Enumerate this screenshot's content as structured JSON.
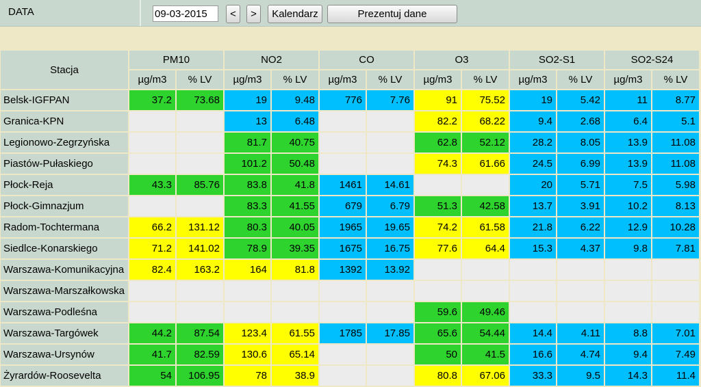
{
  "toolbar": {
    "label": "DATA",
    "date_value": "09-03-2015",
    "prev_label": "<",
    "next_label": ">",
    "calendar_label": "Kalendarz",
    "present_label": "Prezentuj dane"
  },
  "table": {
    "station_header": "Stacja",
    "pollutants": [
      "PM10",
      "NO2",
      "CO",
      "O3",
      "SO2-S1",
      "SO2-S24"
    ],
    "unit_header": "µg/m3",
    "lv_header": "% LV",
    "colors": {
      "g": "#2ed32e",
      "y": "#ffff00",
      "b": "#00bfff",
      "e": "#ececec"
    },
    "rows": [
      {
        "station": "Belsk-IGFPAN",
        "cells": [
          [
            "37.2",
            "g"
          ],
          [
            "73.68",
            "g"
          ],
          [
            "19",
            "b"
          ],
          [
            "9.48",
            "b"
          ],
          [
            "776",
            "b"
          ],
          [
            "7.76",
            "b"
          ],
          [
            "91",
            "y"
          ],
          [
            "75.52",
            "y"
          ],
          [
            "19",
            "b"
          ],
          [
            "5.42",
            "b"
          ],
          [
            "11",
            "b"
          ],
          [
            "8.77",
            "b"
          ]
        ]
      },
      {
        "station": "Granica-KPN",
        "cells": [
          [
            "",
            "e"
          ],
          [
            "",
            "e"
          ],
          [
            "13",
            "b"
          ],
          [
            "6.48",
            "b"
          ],
          [
            "",
            "e"
          ],
          [
            "",
            "e"
          ],
          [
            "82.2",
            "y"
          ],
          [
            "68.22",
            "y"
          ],
          [
            "9.4",
            "b"
          ],
          [
            "2.68",
            "b"
          ],
          [
            "6.4",
            "b"
          ],
          [
            "5.1",
            "b"
          ]
        ]
      },
      {
        "station": "Legionowo-Zegrzyńska",
        "cells": [
          [
            "",
            "e"
          ],
          [
            "",
            "e"
          ],
          [
            "81.7",
            "g"
          ],
          [
            "40.75",
            "g"
          ],
          [
            "",
            "e"
          ],
          [
            "",
            "e"
          ],
          [
            "62.8",
            "g"
          ],
          [
            "52.12",
            "g"
          ],
          [
            "28.2",
            "b"
          ],
          [
            "8.05",
            "b"
          ],
          [
            "13.9",
            "b"
          ],
          [
            "11.08",
            "b"
          ]
        ]
      },
      {
        "station": "Piastów-Pułaskiego",
        "cells": [
          [
            "",
            "e"
          ],
          [
            "",
            "e"
          ],
          [
            "101.2",
            "g"
          ],
          [
            "50.48",
            "g"
          ],
          [
            "",
            "e"
          ],
          [
            "",
            "e"
          ],
          [
            "74.3",
            "y"
          ],
          [
            "61.66",
            "y"
          ],
          [
            "24.5",
            "b"
          ],
          [
            "6.99",
            "b"
          ],
          [
            "13.9",
            "b"
          ],
          [
            "11.08",
            "b"
          ]
        ]
      },
      {
        "station": "Płock-Reja",
        "cells": [
          [
            "43.3",
            "g"
          ],
          [
            "85.76",
            "g"
          ],
          [
            "83.8",
            "g"
          ],
          [
            "41.8",
            "g"
          ],
          [
            "1461",
            "b"
          ],
          [
            "14.61",
            "b"
          ],
          [
            "",
            "e"
          ],
          [
            "",
            "e"
          ],
          [
            "20",
            "b"
          ],
          [
            "5.71",
            "b"
          ],
          [
            "7.5",
            "b"
          ],
          [
            "5.98",
            "b"
          ]
        ]
      },
      {
        "station": "Płock-Gimnazjum",
        "cells": [
          [
            "",
            "e"
          ],
          [
            "",
            "e"
          ],
          [
            "83.3",
            "g"
          ],
          [
            "41.55",
            "g"
          ],
          [
            "679",
            "b"
          ],
          [
            "6.79",
            "b"
          ],
          [
            "51.3",
            "g"
          ],
          [
            "42.58",
            "g"
          ],
          [
            "13.7",
            "b"
          ],
          [
            "3.91",
            "b"
          ],
          [
            "10.2",
            "b"
          ],
          [
            "8.13",
            "b"
          ]
        ]
      },
      {
        "station": "Radom-Tochtermana",
        "cells": [
          [
            "66.2",
            "y"
          ],
          [
            "131.12",
            "y"
          ],
          [
            "80.3",
            "g"
          ],
          [
            "40.05",
            "g"
          ],
          [
            "1965",
            "b"
          ],
          [
            "19.65",
            "b"
          ],
          [
            "74.2",
            "y"
          ],
          [
            "61.58",
            "y"
          ],
          [
            "21.8",
            "b"
          ],
          [
            "6.22",
            "b"
          ],
          [
            "12.9",
            "b"
          ],
          [
            "10.28",
            "b"
          ]
        ]
      },
      {
        "station": "Siedlce-Konarskiego",
        "cells": [
          [
            "71.2",
            "y"
          ],
          [
            "141.02",
            "y"
          ],
          [
            "78.9",
            "g"
          ],
          [
            "39.35",
            "g"
          ],
          [
            "1675",
            "b"
          ],
          [
            "16.75",
            "b"
          ],
          [
            "77.6",
            "y"
          ],
          [
            "64.4",
            "y"
          ],
          [
            "15.3",
            "b"
          ],
          [
            "4.37",
            "b"
          ],
          [
            "9.8",
            "b"
          ],
          [
            "7.81",
            "b"
          ]
        ]
      },
      {
        "station": "Warszawa-Komunikacyjna",
        "cells": [
          [
            "82.4",
            "y"
          ],
          [
            "163.2",
            "y"
          ],
          [
            "164",
            "y"
          ],
          [
            "81.8",
            "y"
          ],
          [
            "1392",
            "b"
          ],
          [
            "13.92",
            "b"
          ],
          [
            "",
            "e"
          ],
          [
            "",
            "e"
          ],
          [
            "",
            "e"
          ],
          [
            "",
            "e"
          ],
          [
            "",
            "e"
          ],
          [
            "",
            "e"
          ]
        ]
      },
      {
        "station": "Warszawa-Marszałkowska",
        "cells": [
          [
            "",
            "e"
          ],
          [
            "",
            "e"
          ],
          [
            "",
            "e"
          ],
          [
            "",
            "e"
          ],
          [
            "",
            "e"
          ],
          [
            "",
            "e"
          ],
          [
            "",
            "e"
          ],
          [
            "",
            "e"
          ],
          [
            "",
            "e"
          ],
          [
            "",
            "e"
          ],
          [
            "",
            "e"
          ],
          [
            "",
            "e"
          ]
        ]
      },
      {
        "station": "Warszawa-Podleśna",
        "cells": [
          [
            "",
            "e"
          ],
          [
            "",
            "e"
          ],
          [
            "",
            "e"
          ],
          [
            "",
            "e"
          ],
          [
            "",
            "e"
          ],
          [
            "",
            "e"
          ],
          [
            "59.6",
            "g"
          ],
          [
            "49.46",
            "g"
          ],
          [
            "",
            "e"
          ],
          [
            "",
            "e"
          ],
          [
            "",
            "e"
          ],
          [
            "",
            "e"
          ]
        ]
      },
      {
        "station": "Warszawa-Targówek",
        "cells": [
          [
            "44.2",
            "g"
          ],
          [
            "87.54",
            "g"
          ],
          [
            "123.4",
            "y"
          ],
          [
            "61.55",
            "y"
          ],
          [
            "1785",
            "b"
          ],
          [
            "17.85",
            "b"
          ],
          [
            "65.6",
            "g"
          ],
          [
            "54.44",
            "g"
          ],
          [
            "14.4",
            "b"
          ],
          [
            "4.11",
            "b"
          ],
          [
            "8.8",
            "b"
          ],
          [
            "7.01",
            "b"
          ]
        ]
      },
      {
        "station": "Warszawa-Ursynów",
        "cells": [
          [
            "41.7",
            "g"
          ],
          [
            "82.59",
            "g"
          ],
          [
            "130.6",
            "y"
          ],
          [
            "65.14",
            "y"
          ],
          [
            "",
            "e"
          ],
          [
            "",
            "e"
          ],
          [
            "50",
            "g"
          ],
          [
            "41.5",
            "g"
          ],
          [
            "16.6",
            "b"
          ],
          [
            "4.74",
            "b"
          ],
          [
            "9.4",
            "b"
          ],
          [
            "7.49",
            "b"
          ]
        ]
      },
      {
        "station": "Żyrardów-Roosevelta",
        "cells": [
          [
            "54",
            "g"
          ],
          [
            "106.95",
            "g"
          ],
          [
            "78",
            "y"
          ],
          [
            "38.9",
            "y"
          ],
          [
            "",
            "e"
          ],
          [
            "",
            "e"
          ],
          [
            "80.8",
            "y"
          ],
          [
            "67.06",
            "y"
          ],
          [
            "33.3",
            "b"
          ],
          [
            "9.5",
            "b"
          ],
          [
            "14.3",
            "b"
          ],
          [
            "11.4",
            "b"
          ]
        ]
      }
    ]
  }
}
